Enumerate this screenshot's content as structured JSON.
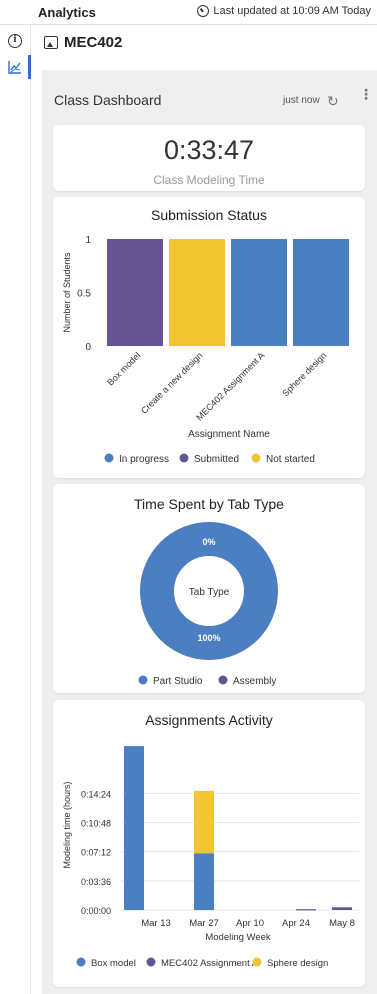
{
  "header": {
    "title": "Analytics",
    "updated": "Last updated at 10:09 AM Today",
    "clock_icon": "clock-icon"
  },
  "rail": {
    "info_icon": "info-icon",
    "chart_icon": "chart-icon",
    "info_glyph": "i"
  },
  "course": {
    "title": "MEC402",
    "icon": "image-icon"
  },
  "dashboard": {
    "title": "Class Dashboard",
    "refreshed": "just now",
    "refresh_glyph": "↻",
    "menu_glyph": "⋮"
  },
  "modeling_time": {
    "value": "0:33:47",
    "label": "Class Modeling Time"
  },
  "colors": {
    "in_progress": "#4b7fc1",
    "submitted": "#645491",
    "not_started": "#f1c530",
    "part_studio": "#4b7fc1",
    "assembly": "#645491",
    "box_model": "#4b7fc1",
    "mec402_a": "#645491",
    "sphere": "#f1c530"
  },
  "chart_data": [
    {
      "type": "bar",
      "title": "Submission Status",
      "xlabel": "Assignment Name",
      "ylabel": "Number of Students",
      "categories": [
        "Box model",
        "Create a new design",
        "MEC402 Assignment A",
        "Sphere design"
      ],
      "y_ticks": [
        "1",
        "0.5",
        "0"
      ],
      "ylim": [
        0,
        1
      ],
      "values": [
        1,
        1,
        1,
        1
      ],
      "status": [
        "Submitted",
        "Not started",
        "In progress",
        "In progress"
      ],
      "legend": [
        "In progress",
        "Submitted",
        "Not started"
      ]
    },
    {
      "type": "pie",
      "title": "Time Spent by Tab Type",
      "center_label": "Tab Type",
      "slices": [
        {
          "label": "Part Studio",
          "value": 100,
          "display": "100%"
        },
        {
          "label": "Assembly",
          "value": 0,
          "display": "0%"
        }
      ],
      "legend": [
        "Part Studio",
        "Assembly"
      ]
    },
    {
      "type": "bar",
      "title": "Assignments Activity",
      "xlabel": "Modeling Week",
      "ylabel": "Modeling time (hours)",
      "x_ticks": [
        "Mar 13",
        "Mar 27",
        "Apr 10",
        "Apr 24",
        "May 8"
      ],
      "y_ticks": [
        "0:00:00",
        "0:03:36",
        "0:07:12",
        "0:10:48",
        "0:14:24"
      ],
      "ylim_seconds": [
        0,
        1260
      ],
      "series": [
        {
          "name": "Box model",
          "values": [
            1215,
            420,
            0,
            4,
            0
          ]
        },
        {
          "name": "MEC402 Assignment A",
          "values": [
            0,
            0,
            0,
            2,
            20
          ]
        },
        {
          "name": "Sphere design",
          "values": [
            0,
            463,
            0,
            0,
            0
          ]
        }
      ],
      "legend": [
        "Box model",
        "MEC402 Assignment A",
        "Sphere design"
      ]
    }
  ]
}
